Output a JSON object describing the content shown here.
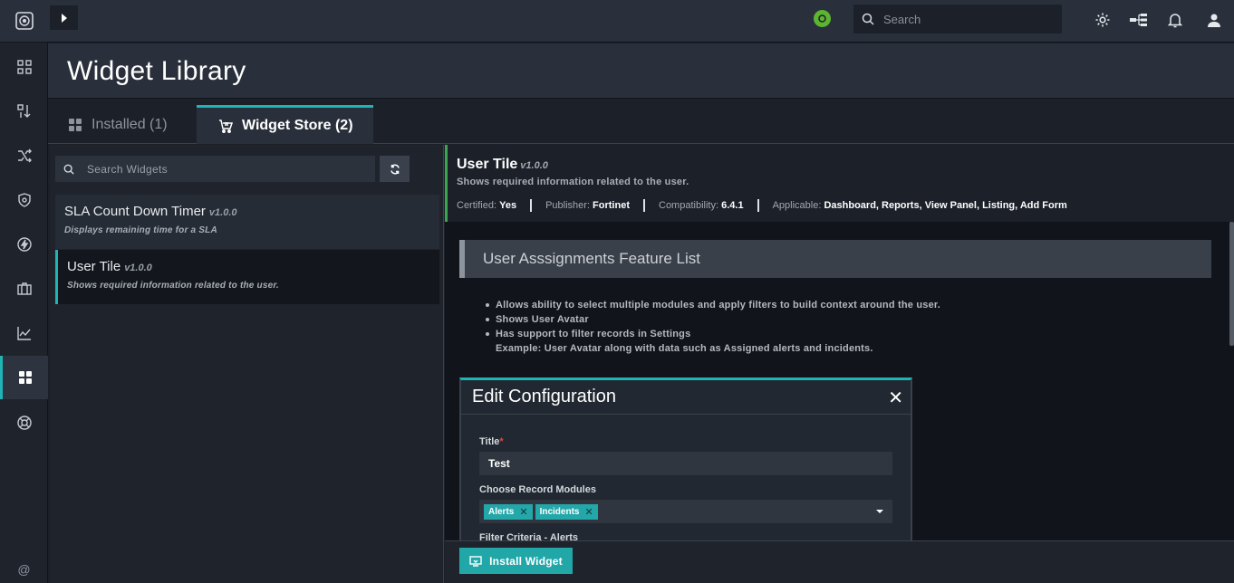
{
  "topbar": {
    "search_placeholder": "Search"
  },
  "rail": {
    "items": [
      "dashboard-icon",
      "sort-icon",
      "shuffle-icon",
      "shield-icon",
      "bolt-icon",
      "briefcase-icon",
      "chart-icon",
      "widgets-icon",
      "help-icon"
    ],
    "active_item": "widgets-icon",
    "footer_symbol": "@"
  },
  "page": {
    "title": "Widget Library"
  },
  "tabs": {
    "installed_label": "Installed (1)",
    "store_label": "Widget Store (2)"
  },
  "list": {
    "search_placeholder": "Search Widgets",
    "widgets": [
      {
        "name": "SLA Count Down Timer",
        "version": "v1.0.0",
        "description": "Displays remaining time for a SLA"
      },
      {
        "name": "User Tile",
        "version": "v1.0.0",
        "description": "Shows required information related to the user."
      }
    ],
    "selected_index": 1
  },
  "detail": {
    "name": "User Tile",
    "version": "v1.0.0",
    "summary": "Shows required information related to the user.",
    "certified_label": "Certified:",
    "certified_value": "Yes",
    "publisher_label": "Publisher:",
    "publisher_value": "Fortinet",
    "compat_label": "Compatibility:",
    "compat_value": "6.4.1",
    "applicable_label": "Applicable:",
    "applicable_value": "Dashboard, Reports, View Panel, Listing, Add Form",
    "feature_heading": "User Asssignments Feature List",
    "bullets": [
      "Allows ability to select multiple modules and apply filters to build context around the user.",
      "Shows User Avatar",
      "Has support to filter records in Settings"
    ],
    "example_line": "Example: User Avatar along with data such as Assigned alerts and incidents.",
    "screenshot": {
      "title": "Edit Configuration",
      "close": "✕",
      "title_label": "Title",
      "required_mark": "*",
      "title_value": "Test",
      "modules_label": "Choose Record Modules",
      "chips": [
        "Alerts",
        "Incidents"
      ],
      "chip_remove": "✕",
      "filter_label": "Filter Criteria - Alerts"
    }
  },
  "footer": {
    "install_label": "Install Widget"
  },
  "colors": {
    "accent": "#1fb5b7",
    "certified_border": "#3aa64e",
    "status_green": "#5cb531"
  }
}
